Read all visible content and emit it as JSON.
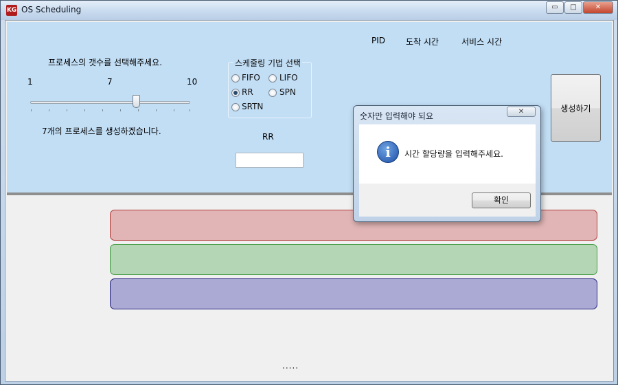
{
  "window": {
    "title": "OS Scheduling",
    "app_icon_text": "KG",
    "minimize": "▭",
    "maximize": "□",
    "close": "✕"
  },
  "process_count": {
    "prompt": "프로세스의 갯수를 선택해주세요.",
    "min_label": "1",
    "mid_label": "7",
    "max_label": "10",
    "value": 7,
    "result_text": "7개의 프로세스를 생성하겠습니다."
  },
  "scheduling": {
    "group_title": "스케줄링 기법 선택",
    "options": [
      {
        "label": "FIFO",
        "checked": false
      },
      {
        "label": "LIFO",
        "checked": false
      },
      {
        "label": "RR",
        "checked": true
      },
      {
        "label": "SPN",
        "checked": false
      },
      {
        "label": "SRTN",
        "checked": false
      }
    ],
    "selected_label": "RR",
    "quantum_value": ""
  },
  "table_headers": {
    "pid": "PID",
    "arrival": "도착 시간",
    "service": "서비스 시간"
  },
  "generate_button": "생성하기",
  "bars": {
    "colors": [
      "#e1b5b5",
      "#b5d6b5",
      "#aaaad4"
    ]
  },
  "status_dots": ".....",
  "dialog": {
    "title": "숫자만 입력해야 되요",
    "close": "✕",
    "icon": "info-icon",
    "message": "시간 할당량을 입력해주세요.",
    "ok_label": "확인"
  }
}
